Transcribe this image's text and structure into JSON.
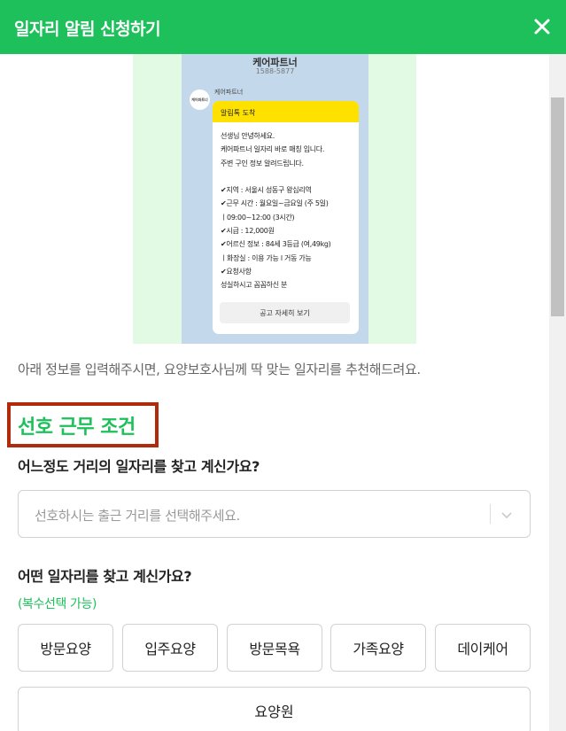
{
  "header": {
    "title": "일자리 알림 신청하기",
    "close_icon": "close-icon"
  },
  "promo": {
    "phone_name": "케어파트너",
    "phone_number": "1588-5877",
    "avatar_text": "케어파트너",
    "sender": "케어파트너",
    "bubble_header": "알림톡 도착",
    "bubble_lines": [
      "선생님 안녕하세요.",
      "케어파트너 일자리 바로 매칭 입니다.",
      "주변 구인 정보 알려드립니다.",
      "",
      "✔지역 : 서울시 성동구 왕십리역",
      "✔근무 시간 : 월요일~금요일 (주 5일)",
      "ㅣ09:00~12:00 (3시간)",
      "✔시급 : 12,000원",
      "✔어르신 정보 : 84세 3등급 (여,49kg)",
      "ㅣ화장실 : 이용 가능 l 거동 가능",
      "✔요청사항",
      "성실하시고 꼼꼼하신 분"
    ],
    "bubble_button": "공고 자세히 보기"
  },
  "intro_text": "아래 정보를 입력해주시면, 요양보호사님께 딱 맞는 일자리를 추천해드려요.",
  "section_title": "선호 근무 조건",
  "distance": {
    "question": "어느정도 거리의 일자리를 찾고 계신가요?",
    "placeholder": "선호하시는 출근 거리를 선택해주세요.",
    "arrow_icon": "chevron-down-icon"
  },
  "job_type": {
    "question": "어떤 일자리를 찾고 계신가요?",
    "note": "(복수선택 가능)",
    "options": [
      "방문요양",
      "입주요양",
      "방문목욕",
      "가족요양",
      "데이케어",
      "요양원"
    ]
  },
  "colors": {
    "brand": "#1ec05b",
    "highlight_border": "#b02a0c",
    "kakao_yellow": "#ffe100"
  }
}
